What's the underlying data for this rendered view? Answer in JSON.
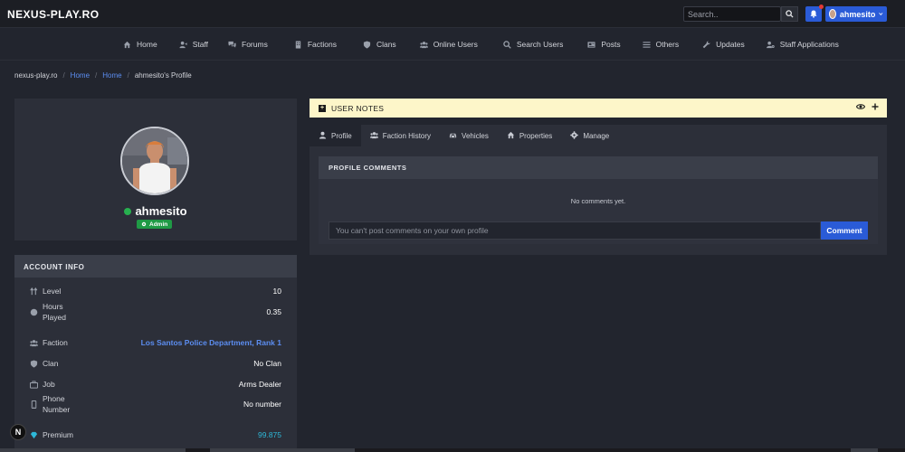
{
  "topbar": {
    "brand": "NEXUS-PLAY.RO",
    "search_placeholder": "Search..",
    "username": "ahmesito"
  },
  "nav": {
    "items": [
      {
        "label": "Home",
        "icon": "home-icon"
      },
      {
        "label": "Staff",
        "icon": "user-tie-icon"
      },
      {
        "label": "Forums",
        "icon": "comments-icon"
      },
      {
        "label": "Factions",
        "icon": "building-icon"
      },
      {
        "label": "Clans",
        "icon": "shield-icon"
      },
      {
        "label": "Online Users",
        "icon": "users-icon"
      },
      {
        "label": "Search Users",
        "icon": "search-icon"
      },
      {
        "label": "Posts",
        "icon": "newspaper-icon"
      },
      {
        "label": "Others",
        "icon": "list-icon"
      },
      {
        "label": "Updates",
        "icon": "wrench-icon"
      },
      {
        "label": "Staff Applications",
        "icon": "user-cog-icon"
      }
    ]
  },
  "breadcrumb": {
    "site": "nexus-play.ro",
    "home1": "Home",
    "home2": "Home",
    "current": "ahmesito's Profile"
  },
  "profile": {
    "username": "ahmesito",
    "badge": "Admin",
    "status_color": "#27b04f"
  },
  "account": {
    "title": "ACCOUNT INFO",
    "rows": [
      {
        "label": "Level",
        "value": "10",
        "icon": "level-icon"
      },
      {
        "label": "Hours Played",
        "value": "0.35",
        "icon": "clock-icon"
      },
      {
        "label": "Faction",
        "value": "Los Santos Police Department, Rank 1",
        "icon": "users-icon"
      },
      {
        "label": "Clan",
        "value": "No Clan",
        "icon": "shield-icon"
      },
      {
        "label": "Job",
        "value": "Arms Dealer",
        "icon": "briefcase-icon"
      },
      {
        "label": "Phone Number",
        "value": "No number",
        "icon": "phone-icon"
      },
      {
        "label": "Premium",
        "value": "99.875",
        "icon": "diamond-icon"
      }
    ]
  },
  "notes": {
    "title": "USER NOTES"
  },
  "tabs": [
    {
      "label": "Profile",
      "icon": "user-icon"
    },
    {
      "label": "Faction History",
      "icon": "users-icon"
    },
    {
      "label": "Vehicles",
      "icon": "car-icon"
    },
    {
      "label": "Properties",
      "icon": "home-icon"
    },
    {
      "label": "Manage",
      "icon": "gear-icon"
    }
  ],
  "comments": {
    "title": "PROFILE COMMENTS",
    "empty": "No comments yet.",
    "placeholder": "You can't post comments on your own profile",
    "button": "Comment"
  },
  "floating_badge": "N",
  "colors": {
    "accent": "#2a5bd7",
    "link": "#5c8ef2",
    "notes_bg": "#fdf6c9",
    "badge_green": "#1f9a45"
  }
}
